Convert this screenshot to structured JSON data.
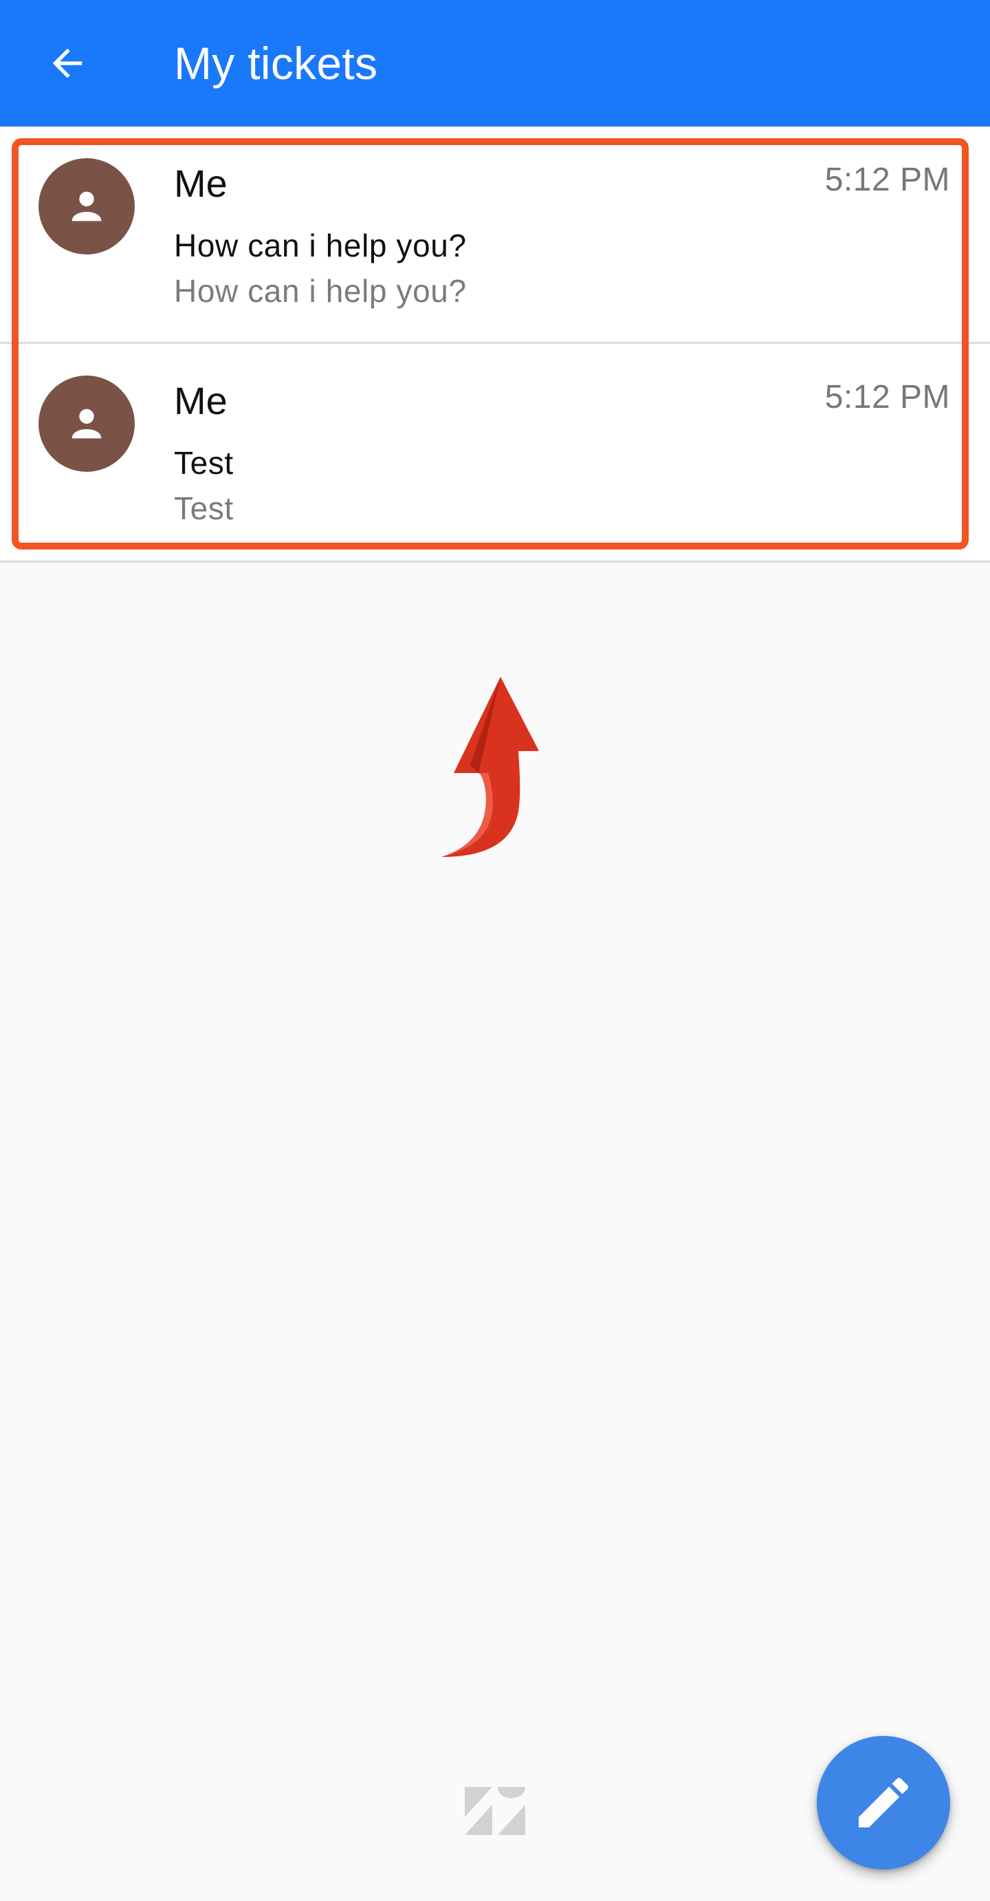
{
  "app_bar": {
    "title": "My tickets",
    "back_icon": "arrow-back-icon",
    "background_color": "#1a78fb"
  },
  "tickets": [
    {
      "author": "Me",
      "time": "5:12 PM",
      "subject": "How can i help you?",
      "preview": "How can i help you?",
      "avatar_icon": "person-icon",
      "avatar_color": "#7a5346"
    },
    {
      "author": "Me",
      "time": "5:12 PM",
      "subject": "Test",
      "preview": "Test",
      "avatar_icon": "person-icon",
      "avatar_color": "#7a5346"
    }
  ],
  "annotations": {
    "highlight_color": "#f05523",
    "arrow_color": "#d9321f",
    "arrow_icon": "curved-up-arrow-icon"
  },
  "footer": {
    "logo_icon": "zendesk-logo-icon"
  },
  "fab": {
    "icon": "pencil-icon",
    "color": "#3e85e8"
  }
}
